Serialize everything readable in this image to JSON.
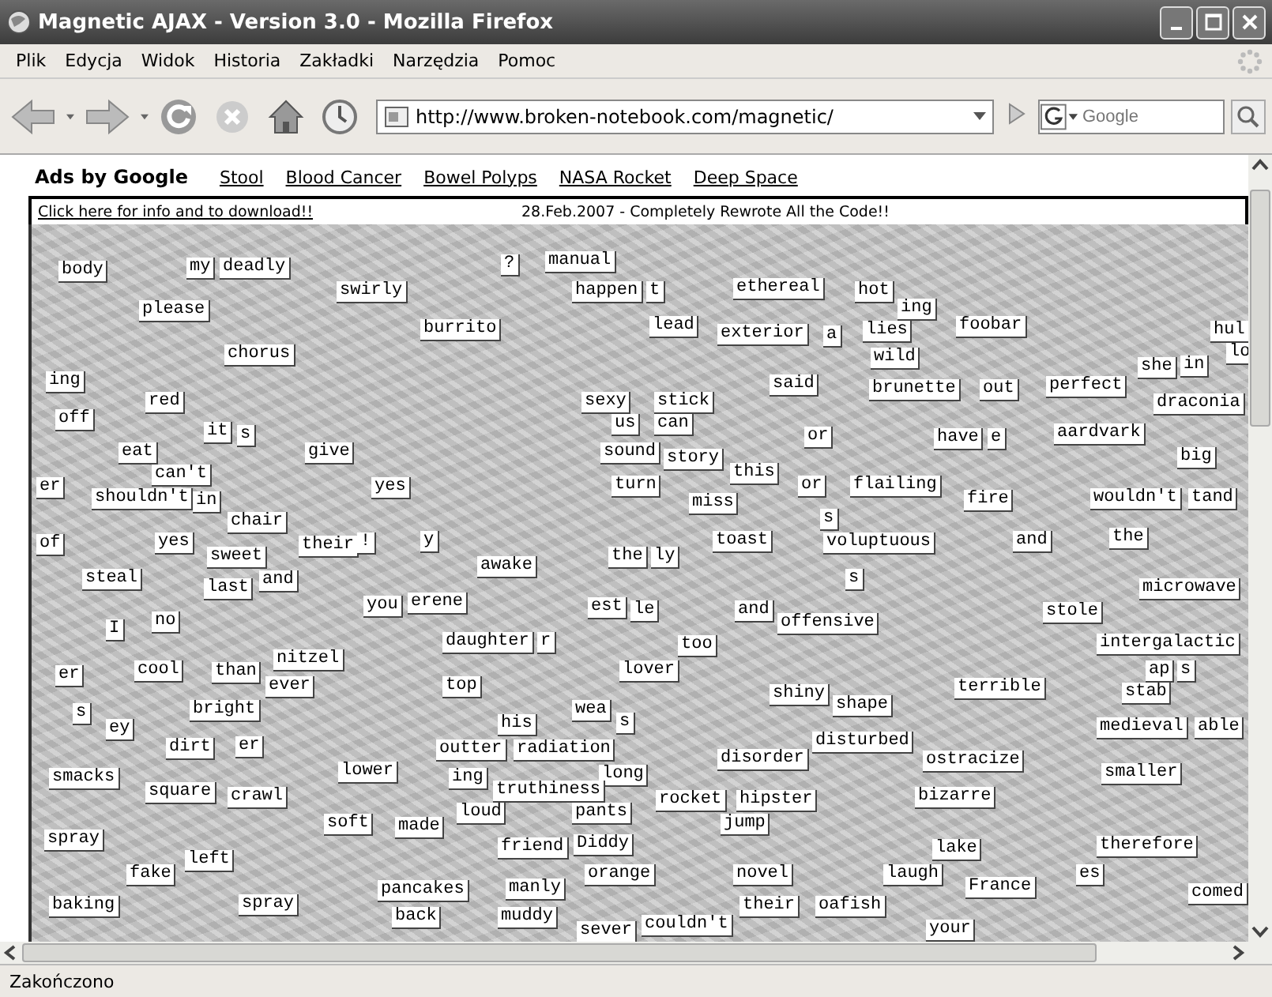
{
  "window": {
    "title": "Magnetic AJAX - Version 3.0 - Mozilla Firefox"
  },
  "menu": [
    "Plik",
    "Edycja",
    "Widok",
    "Historia",
    "Zakładki",
    "Narzędzia",
    "Pomoc"
  ],
  "toolbar": {
    "url": "http://www.broken-notebook.com/magnetic/",
    "search_placeholder": "Google"
  },
  "ads": {
    "title": "Ads by Google",
    "links": [
      "Stool",
      "Blood Cancer",
      "Bowel Polyps",
      "NASA Rocket",
      "Deep Space"
    ]
  },
  "notice": {
    "link": "Click here for info and to download!!",
    "message": "28.Feb.2007 - Completely Rewrote All the Code!!"
  },
  "magnets": [
    "body",
    "my",
    "deadly",
    "?",
    "manual",
    "swirly",
    "happen",
    "t",
    "ethereal",
    "hot",
    "please",
    "ing",
    "burrito",
    "lead",
    "exterior",
    "a",
    "lies",
    "foobar",
    "hul",
    "chorus",
    "wild",
    "lo",
    "she",
    "in",
    "ing",
    "said",
    "brunette",
    "out",
    "perfect",
    "red",
    "sexy",
    "stick",
    "draconia",
    "off",
    "us",
    "can",
    "it",
    "s",
    "or",
    "have",
    "e",
    "aardvark",
    "eat",
    "give",
    "sound",
    "story",
    "big",
    "can't",
    "this",
    "er",
    "yes",
    "turn",
    "or",
    "flailing",
    "shouldn't",
    "in",
    "miss",
    "fire",
    "wouldn't",
    "tand",
    "chair",
    "s",
    "of",
    "yes",
    "their",
    "!",
    "y",
    "toast",
    "voluptuous",
    "and",
    "the",
    "sweet",
    "the",
    "ly",
    "awake",
    "steal",
    "last",
    "and",
    "s",
    "microwave",
    "you",
    "erene",
    "est",
    "le",
    "and",
    "stole",
    "I",
    "no",
    "offensive",
    "daughter",
    "r",
    "too",
    "intergalactic",
    "nitzel",
    "er",
    "cool",
    "than",
    "lover",
    "ap",
    "s",
    "ever",
    "top",
    "shiny",
    "terrible",
    "stab",
    "s",
    "bright",
    "wea",
    "shape",
    "ey",
    "his",
    "s",
    "medieval",
    "able",
    "dirt",
    "er",
    "outter",
    "radiation",
    "disturbed",
    "disorder",
    "ostracize",
    "smacks",
    "lower",
    "ing",
    "long",
    "smaller",
    "square",
    "crawl",
    "truthiness",
    "rocket",
    "hipster",
    "bizarre",
    "loud",
    "pants",
    "soft",
    "made",
    "jump",
    "spray",
    "friend",
    "Diddy",
    "lake",
    "therefore",
    "left",
    "fake",
    "orange",
    "novel",
    "laugh",
    "es",
    "pancakes",
    "manly",
    "France",
    "comed",
    "baking",
    "spray",
    "their",
    "oafish",
    "back",
    "muddy",
    "sever",
    "couldn't",
    "your"
  ],
  "status_bar": "Zakończono"
}
